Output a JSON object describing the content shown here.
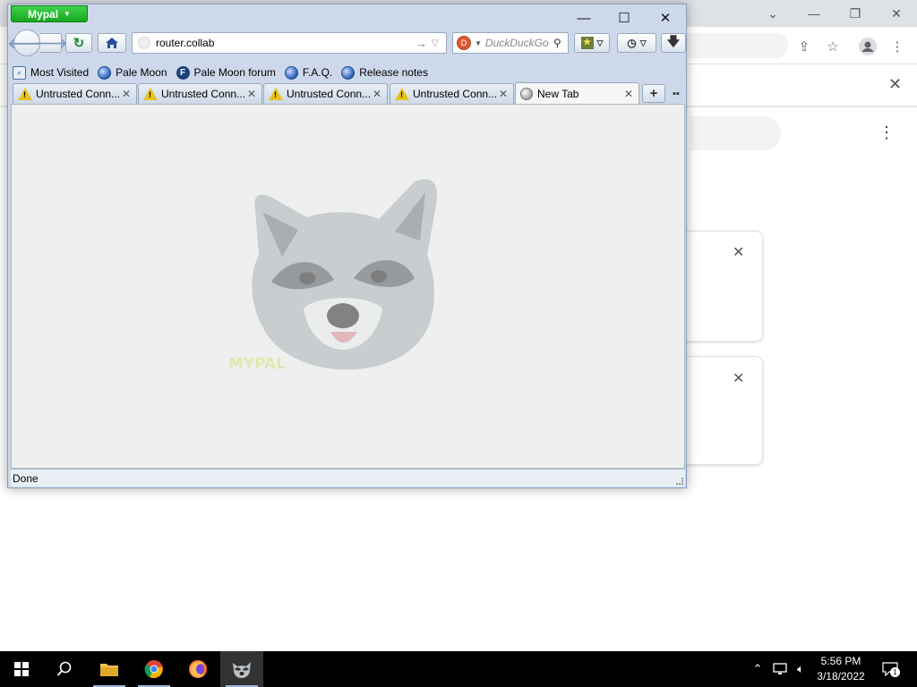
{
  "mypal_window": {
    "app_button": "Mypal",
    "url": "router.collab",
    "search_placeholder": "DuckDuckGo",
    "bookmarks": [
      {
        "label": "Most Visited",
        "icon": "most-visited-icon"
      },
      {
        "label": "Pale Moon",
        "icon": "globe-icon"
      },
      {
        "label": "Pale Moon forum",
        "icon": "forum-f-icon"
      },
      {
        "label": "F.A.Q.",
        "icon": "globe-icon"
      },
      {
        "label": "Release notes",
        "icon": "globe-icon"
      }
    ],
    "tabs": [
      {
        "label": "Untrusted Conn...",
        "icon": "warning-icon",
        "active": false
      },
      {
        "label": "Untrusted Conn...",
        "icon": "warning-icon",
        "active": false
      },
      {
        "label": "Untrusted Conn...",
        "icon": "warning-icon",
        "active": false
      },
      {
        "label": "Untrusted Conn...",
        "icon": "warning-icon",
        "active": false
      },
      {
        "label": "New Tab",
        "icon": "globe-icon",
        "active": true
      }
    ],
    "watermark_text": "MYPAL",
    "status": "Done",
    "accent_color": "#1fb52a"
  },
  "taskbar": {
    "apps": [
      "windows-start-icon",
      "search-icon",
      "file-explorer-icon",
      "chrome-icon",
      "firefox-icon",
      "mypal-icon"
    ],
    "time": "5:56 PM",
    "date": "3/18/2022",
    "notification_count": "1"
  }
}
